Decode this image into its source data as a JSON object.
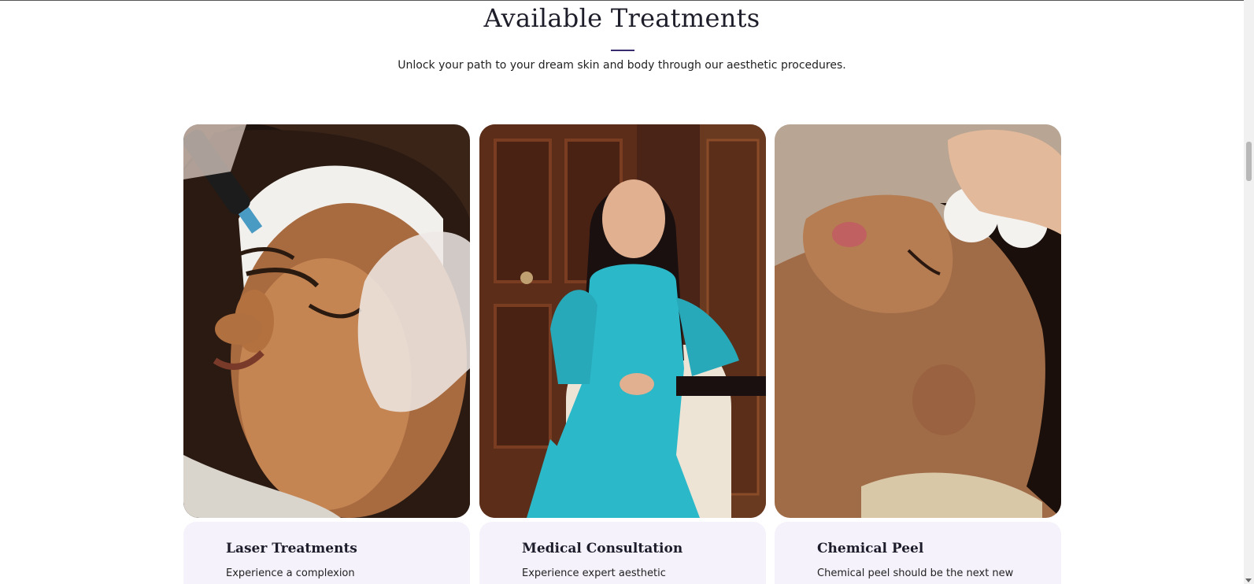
{
  "section": {
    "title": "Available Treatments",
    "subtitle": "Unlock your path to your dream skin and body through our aesthetic procedures."
  },
  "cards": [
    {
      "title": "Laser Treatments",
      "text": "Experience a complexion",
      "image": "facial-laser-treatment-photo"
    },
    {
      "title": "Medical Consultation",
      "text": "Experience expert aesthetic",
      "image": "doctor-portrait-photo"
    },
    {
      "title": "Chemical Peel",
      "text": "Chemical peel should be the next new",
      "image": "chemical-peel-facial-photo"
    }
  ],
  "colors": {
    "accent": "#3a2a6e",
    "card_background": "#f5f2fb",
    "teal_outfit": "#2bb8c9"
  }
}
